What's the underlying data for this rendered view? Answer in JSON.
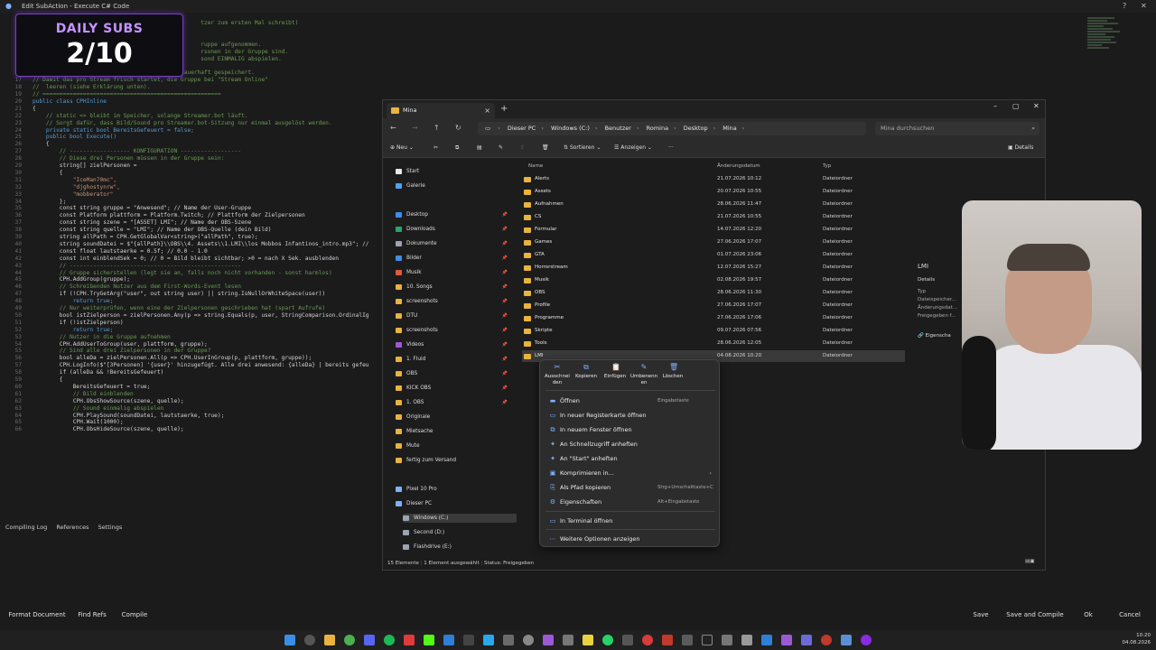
{
  "titlebar": {
    "title": "Edit SubAction - Execute C# Code",
    "help": "?",
    "close": "✕"
  },
  "overlay": {
    "label": "DAILY SUBS",
    "count": "2/10"
  },
  "code": {
    "lines": [
      {
        "n": "",
        "t": "                                                  tzer zum ersten Mal schreibt)",
        "c": "c-com"
      },
      {
        "n": "",
        "t": "",
        "c": ""
      },
      {
        "n": "",
        "t": "",
        "c": ""
      },
      {
        "n": "",
        "t": "                                                  ruppe aufgenommen.",
        "c": "c-com"
      },
      {
        "n": "",
        "t": "                                                  rsonen in der Gruppe sind.",
        "c": "c-com"
      },
      {
        "n": "",
        "t": "                                                  sond EINMALIG abspielen.",
        "c": "c-com"
      },
      {
        "n": "",
        "t": "",
        "c": ""
      },
      {
        "n": "16",
        "t": "// Hinweis: Gruppen bleiben in Streamer.bot dauerhaft gespeichert.",
        "c": "c-com"
      },
      {
        "n": "17",
        "t": "// Damit das pro Stream frisch startet, die Gruppe bei \"Stream Online\"",
        "c": "c-com"
      },
      {
        "n": "18",
        "t": "//  leeren (siehe Erklärung unten).",
        "c": "c-com"
      },
      {
        "n": "19",
        "t": "// =====================================================",
        "c": "c-com"
      },
      {
        "n": "20",
        "t": "public class CPHInline",
        "c": "c-kw"
      },
      {
        "n": "21",
        "t": "{",
        "c": ""
      },
      {
        "n": "22",
        "t": "    // static => bleibt im Speicher, solange Streamer.bot läuft.",
        "c": "c-com"
      },
      {
        "n": "23",
        "t": "    // Sorgt dafür, dass Bild/Sound pro Streamer.bot-Sitzung nur einmal ausgelöst werden.",
        "c": "c-com"
      },
      {
        "n": "24",
        "t": "    private static bool BereitsGefeuert = false;",
        "c": "c-kw"
      },
      {
        "n": "25",
        "t": "    public bool Execute()",
        "c": "c-kw"
      },
      {
        "n": "26",
        "t": "    {",
        "c": ""
      },
      {
        "n": "27",
        "t": "        // ------------------ KONFIGURATION ------------------",
        "c": "c-com"
      },
      {
        "n": "28",
        "t": "        // Diese drei Personen müssen in der Gruppe sein:",
        "c": "c-com"
      },
      {
        "n": "29",
        "t": "        string[] zielPersonen =",
        "c": ""
      },
      {
        "n": "30",
        "t": "        {",
        "c": ""
      },
      {
        "n": "31",
        "t": "            \"IceMan70mc\",",
        "c": "c-str"
      },
      {
        "n": "32",
        "t": "            \"djghostynrw\",",
        "c": "c-str"
      },
      {
        "n": "33",
        "t": "            \"mobberator\"",
        "c": "c-str"
      },
      {
        "n": "34",
        "t": "        };",
        "c": ""
      },
      {
        "n": "35",
        "t": "        const string gruppe = \"Anwesend\"; // Name der User-Gruppe",
        "c": ""
      },
      {
        "n": "36",
        "t": "        const Platform plattform = Platform.Twitch; // Plattform der Zielpersonen",
        "c": ""
      },
      {
        "n": "37",
        "t": "        const string szene = \"[ASSET] LMI\"; // Name der OBS-Szene",
        "c": ""
      },
      {
        "n": "38",
        "t": "        const string quelle = \"LMI\"; // Name der OBS-Quelle (dein Bild)",
        "c": ""
      },
      {
        "n": "39",
        "t": "        string allPath = CPH.GetGlobalVar<string>(\"allPath\", true);",
        "c": ""
      },
      {
        "n": "40",
        "t": "        string soundDatei = $\"{allPath}\\\\OBS\\\\4. Assets\\\\1.LMI\\\\los Mobbos Infantinos_intro.mp3\"; //",
        "c": ""
      },
      {
        "n": "41",
        "t": "        const float lautstaerke = 0.5f; // 0.0 - 1.0",
        "c": ""
      },
      {
        "n": "42",
        "t": "        const int einblendSek = 0; // 0 = Bild bleibt sichtbar; >0 = nach X Sek. ausblenden",
        "c": ""
      },
      {
        "n": "43",
        "t": "        // ---------------------------------------------------",
        "c": "c-com"
      },
      {
        "n": "44",
        "t": "        // Gruppe sicherstellen (legt sie an, falls noch nicht vorhanden - sonst harmlos)",
        "c": "c-com"
      },
      {
        "n": "45",
        "t": "        CPH.AddGroup(gruppe);",
        "c": ""
      },
      {
        "n": "46",
        "t": "        // Schreibenden Nutzer aus dem First-Words-Event lesen",
        "c": "c-com"
      },
      {
        "n": "47",
        "t": "        if (!CPH.TryGetArg(\"user\", out string user) || string.IsNullOrWhiteSpace(user))",
        "c": ""
      },
      {
        "n": "48",
        "t": "            return true;",
        "c": "c-kw"
      },
      {
        "n": "49",
        "t": "        // Nur weiterprüfen, wenn eine der Zielpersonen geschrieben hat (spart Aufrufe)",
        "c": "c-com"
      },
      {
        "n": "50",
        "t": "        bool istZielperson = zielPersonen.Any(p => string.Equals(p, user, StringComparison.OrdinalIg",
        "c": ""
      },
      {
        "n": "51",
        "t": "        if (!istZielperson)",
        "c": ""
      },
      {
        "n": "52",
        "t": "            return true;",
        "c": "c-kw"
      },
      {
        "n": "53",
        "t": "        // Nutzer in die Gruppe aufnehmen",
        "c": "c-com"
      },
      {
        "n": "54",
        "t": "        CPH.AddUserToGroup(user, plattform, gruppe);",
        "c": ""
      },
      {
        "n": "55",
        "t": "        // Sind alle drei Zielpersonen in der Gruppe?",
        "c": "c-com"
      },
      {
        "n": "56",
        "t": "        bool alleDa = zielPersonen.All(p => CPH.UserInGroup(p, plattform, gruppe));",
        "c": ""
      },
      {
        "n": "57",
        "t": "        CPH.LogInfo($\"[3Personen] '{user}' hinzugefügt. Alle drei anwesend: {alleDa} | bereits gefeu",
        "c": ""
      },
      {
        "n": "58",
        "t": "        if (alleDa && !BereitsGefeuert)",
        "c": ""
      },
      {
        "n": "59",
        "t": "        {",
        "c": ""
      },
      {
        "n": "60",
        "t": "            BereitsGefeuert = true;",
        "c": ""
      },
      {
        "n": "61",
        "t": "            // Bild einblenden",
        "c": "c-com"
      },
      {
        "n": "62",
        "t": "            CPH.ObsShowSource(szene, quelle);",
        "c": ""
      },
      {
        "n": "63",
        "t": "            // Sound einmalig abspielen",
        "c": "c-com"
      },
      {
        "n": "64",
        "t": "            CPH.PlaySound(soundDatei, lautstaerke, true);",
        "c": ""
      },
      {
        "n": "65",
        "t": "            CPH.Wait(1000);",
        "c": ""
      },
      {
        "n": "66",
        "t": "            CPH.ObsHideSource(szene, quelle);",
        "c": ""
      }
    ],
    "tabs": [
      "Compiling Log",
      "References",
      "Settings"
    ]
  },
  "bottom_buttons": {
    "format": "Format Document",
    "find_refs": "Find Refs",
    "compile": "Compile",
    "save": "Save",
    "save_compile": "Save and Compile",
    "ok": "Ok",
    "cancel": "Cancel"
  },
  "clock": {
    "time": "10:20",
    "date": "04.08.2026"
  },
  "explorer": {
    "tab_title": "Mina",
    "breadcrumb": [
      "Dieser PC",
      "Windows (C:)",
      "Benutzer",
      "Romina",
      "Desktop",
      "Mina"
    ],
    "search_placeholder": "Mina durchsuchen",
    "toolbar": {
      "new": "Neu",
      "sort": "Sortieren",
      "view": "Anzeigen",
      "more": "···",
      "details": "Details"
    },
    "nav": [
      {
        "label": "Start",
        "color": "#e8e8e8",
        "pin": false
      },
      {
        "label": "Galerie",
        "color": "#4aa3ff",
        "pin": false
      },
      {
        "label": "Desktop",
        "color": "#3b8ee6",
        "pin": true
      },
      {
        "label": "Downloads",
        "color": "#2aa56b",
        "pin": true
      },
      {
        "label": "Dokumente",
        "color": "#9aa4b3",
        "pin": true
      },
      {
        "label": "Bilder",
        "color": "#3f8fe0",
        "pin": true
      },
      {
        "label": "Musik",
        "color": "#e05a3f",
        "pin": true
      },
      {
        "label": "10. Songs",
        "color": "#e8b33f",
        "pin": true
      },
      {
        "label": "screenshots",
        "color": "#e8b33f",
        "pin": true
      },
      {
        "label": "DTU",
        "color": "#e8b33f",
        "pin": true
      },
      {
        "label": "screenshots",
        "color": "#e8b33f",
        "pin": true
      },
      {
        "label": "Videos",
        "color": "#9b59d6",
        "pin": true
      },
      {
        "label": "1. Fluid",
        "color": "#e8b33f",
        "pin": true
      },
      {
        "label": "OBS",
        "color": "#e8b33f",
        "pin": true
      },
      {
        "label": "KICK OBS",
        "color": "#e8b33f",
        "pin": true
      },
      {
        "label": "1. OBS",
        "color": "#e8b33f",
        "pin": true
      },
      {
        "label": "Originale",
        "color": "#e8b33f",
        "pin": false
      },
      {
        "label": "Mietsache",
        "color": "#e8b33f",
        "pin": false
      },
      {
        "label": "Mute",
        "color": "#e8b33f",
        "pin": false
      },
      {
        "label": "fertig zum Versand",
        "color": "#e8b33f",
        "pin": false
      },
      {
        "label": "Pixel 10 Pro",
        "color": "#7fb1ff",
        "pin": false
      },
      {
        "label": "Dieser PC",
        "color": "#7fb1ff",
        "pin": false
      },
      {
        "label": "Windows (C:)",
        "color": "#9aa4b3",
        "pin": false
      },
      {
        "label": "Second (D:)",
        "color": "#9aa4b3",
        "pin": false
      },
      {
        "label": "Flashdrive (E:)",
        "color": "#9aa4b3",
        "pin": false
      }
    ],
    "columns": {
      "name": "Name",
      "date": "Änderungsdatum",
      "type": "Typ"
    },
    "files": [
      {
        "name": "Alerts",
        "date": "21.07.2026 10:12",
        "type": "Dateiordner"
      },
      {
        "name": "Assets",
        "date": "20.07.2026 10:55",
        "type": "Dateiordner"
      },
      {
        "name": "Aufnahmen",
        "date": "28.06.2026 11:47",
        "type": "Dateiordner"
      },
      {
        "name": "CS",
        "date": "21.07.2026 10:55",
        "type": "Dateiordner"
      },
      {
        "name": "Formular",
        "date": "14.07.2026 12:20",
        "type": "Dateiordner"
      },
      {
        "name": "Games",
        "date": "27.06.2026 17:07",
        "type": "Dateiordner"
      },
      {
        "name": "GTA",
        "date": "01.07.2026 23:06",
        "type": "Dateiordner"
      },
      {
        "name": "Horrorstream",
        "date": "12.07.2026 15:27",
        "type": "Dateiordner"
      },
      {
        "name": "Musik",
        "date": "02.08.2026 19:57",
        "type": "Dateiordner"
      },
      {
        "name": "OBS",
        "date": "28.06.2026 11:30",
        "type": "Dateiordner"
      },
      {
        "name": "Profile",
        "date": "27.06.2026 17:07",
        "type": "Dateiordner"
      },
      {
        "name": "Programme",
        "date": "27.06.2026 17:06",
        "type": "Dateiordner"
      },
      {
        "name": "Skripte",
        "date": "09.07.2026 07:56",
        "type": "Dateiordner"
      },
      {
        "name": "Tools",
        "date": "28.06.2026 12:05",
        "type": "Dateiordner"
      },
      {
        "name": "LMI",
        "date": "04.08.2026 10:20",
        "type": "Dateiordner"
      }
    ],
    "details_panel": {
      "title": "LMI",
      "heading": "Details",
      "rows": [
        "Typ",
        "Dateispeicher...",
        "Änderungsdat...",
        "Freigegeben f..."
      ],
      "share": "Eigenscha"
    },
    "status": {
      "count": "15 Elemente",
      "selected": "1 Element ausgewählt",
      "status_label": "Status:",
      "status_value": "Freigegeben"
    }
  },
  "context_menu": {
    "quick": [
      {
        "icon": "✂",
        "label": "Ausschnei den"
      },
      {
        "icon": "⧉",
        "label": "Kopieren"
      },
      {
        "icon": "📋",
        "label": "Einfügen"
      },
      {
        "icon": "✎",
        "label": "Umbenenn en"
      },
      {
        "icon": "🗑",
        "label": "Löschen"
      }
    ],
    "items": [
      {
        "label": "Öffnen",
        "shortcut": "Eingabetaste",
        "icon": "▬"
      },
      {
        "label": "In neuer Registerkarte öffnen",
        "shortcut": "",
        "icon": "▭"
      },
      {
        "label": "In neuem Fenster öffnen",
        "shortcut": "",
        "icon": "⧉"
      },
      {
        "label": "An Schnellzugriff anheften",
        "shortcut": "",
        "icon": "✦"
      },
      {
        "label": "An \"Start\" anheften",
        "shortcut": "",
        "icon": "✦"
      },
      {
        "label": "Komprimieren in...",
        "shortcut": "",
        "icon": "▣",
        "arrow": "›"
      },
      {
        "label": "Als Pfad kopieren",
        "shortcut": "Strg+Umschalttaste+C",
        "icon": "⎘"
      },
      {
        "label": "Eigenschaften",
        "shortcut": "Alt+Eingabetaste",
        "icon": "⚙"
      },
      {
        "label": "In Terminal öffnen",
        "shortcut": "",
        "icon": "▭"
      },
      {
        "label": "Weitere Optionen anzeigen",
        "shortcut": "",
        "icon": "⋯"
      }
    ]
  },
  "colors": {
    "accent": "#7a3fc4",
    "folder": "#e8b33f",
    "link": "#7fb1ff"
  }
}
